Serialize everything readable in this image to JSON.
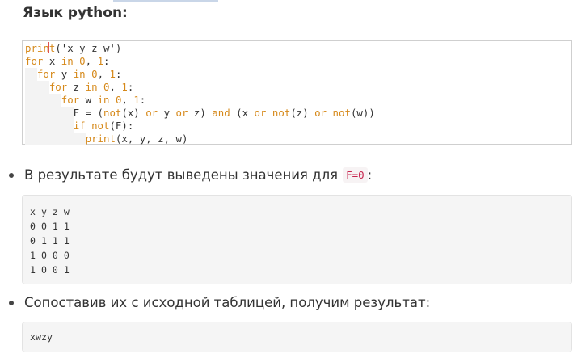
{
  "heading": "Язык python:",
  "code": {
    "lines": [
      [
        {
          "t": "print",
          "c": "kw"
        },
        {
          "t": "('x y z w')",
          "c": "plain"
        }
      ],
      [
        {
          "t": "for",
          "c": "kw"
        },
        {
          "t": " x ",
          "c": "plain"
        },
        {
          "t": "in",
          "c": "kw"
        },
        {
          "t": " ",
          "c": "plain"
        },
        {
          "t": "0",
          "c": "num"
        },
        {
          "t": ", ",
          "c": "plain"
        },
        {
          "t": "1",
          "c": "num"
        },
        {
          "t": ":",
          "c": "plain"
        }
      ],
      [
        {
          "t": "  ",
          "c": "plain"
        },
        {
          "t": "for",
          "c": "kw"
        },
        {
          "t": " y ",
          "c": "plain"
        },
        {
          "t": "in",
          "c": "kw"
        },
        {
          "t": " ",
          "c": "plain"
        },
        {
          "t": "0",
          "c": "num"
        },
        {
          "t": ", ",
          "c": "plain"
        },
        {
          "t": "1",
          "c": "num"
        },
        {
          "t": ":",
          "c": "plain"
        }
      ],
      [
        {
          "t": "    ",
          "c": "plain"
        },
        {
          "t": "for",
          "c": "kw"
        },
        {
          "t": " z ",
          "c": "plain"
        },
        {
          "t": "in",
          "c": "kw"
        },
        {
          "t": " ",
          "c": "plain"
        },
        {
          "t": "0",
          "c": "num"
        },
        {
          "t": ", ",
          "c": "plain"
        },
        {
          "t": "1",
          "c": "num"
        },
        {
          "t": ":",
          "c": "plain"
        }
      ],
      [
        {
          "t": "      ",
          "c": "plain"
        },
        {
          "t": "for",
          "c": "kw"
        },
        {
          "t": " w ",
          "c": "plain"
        },
        {
          "t": "in",
          "c": "kw"
        },
        {
          "t": " ",
          "c": "plain"
        },
        {
          "t": "0",
          "c": "num"
        },
        {
          "t": ", ",
          "c": "plain"
        },
        {
          "t": "1",
          "c": "num"
        },
        {
          "t": ":",
          "c": "plain"
        }
      ],
      [
        {
          "t": "        F = (",
          "c": "plain"
        },
        {
          "t": "not",
          "c": "kw"
        },
        {
          "t": "(x) ",
          "c": "plain"
        },
        {
          "t": "or",
          "c": "kw"
        },
        {
          "t": " y ",
          "c": "plain"
        },
        {
          "t": "or",
          "c": "kw"
        },
        {
          "t": " z) ",
          "c": "plain"
        },
        {
          "t": "and",
          "c": "kw"
        },
        {
          "t": " (x ",
          "c": "plain"
        },
        {
          "t": "or",
          "c": "kw"
        },
        {
          "t": " ",
          "c": "plain"
        },
        {
          "t": "not",
          "c": "kw"
        },
        {
          "t": "(z) ",
          "c": "plain"
        },
        {
          "t": "or",
          "c": "kw"
        },
        {
          "t": " ",
          "c": "plain"
        },
        {
          "t": "not",
          "c": "kw"
        },
        {
          "t": "(w))",
          "c": "plain"
        }
      ],
      [
        {
          "t": "        ",
          "c": "plain"
        },
        {
          "t": "if",
          "c": "kw"
        },
        {
          "t": " ",
          "c": "plain"
        },
        {
          "t": "not",
          "c": "kw"
        },
        {
          "t": "(F):",
          "c": "plain"
        }
      ],
      [
        {
          "t": "          ",
          "c": "plain"
        },
        {
          "t": "print",
          "c": "kw"
        },
        {
          "t": "(x, y, z, w)",
          "c": "plain"
        }
      ]
    ]
  },
  "bullet1": {
    "text": "В результате будут выведены значения для",
    "code": "F=0",
    "suffix": ":"
  },
  "output1": [
    "x y z w",
    "0 0 1 1",
    "0 1 1 1",
    "1 0 0 0",
    "1 0 0 1"
  ],
  "bullet2": {
    "text": "Сопоставив их с исходной таблицей, получим результат:"
  },
  "output2": [
    "xwzy"
  ],
  "colors": {
    "keyword": "#d6891a",
    "inline_code": "#c7254e",
    "pre_background": "#f5f5f5"
  }
}
